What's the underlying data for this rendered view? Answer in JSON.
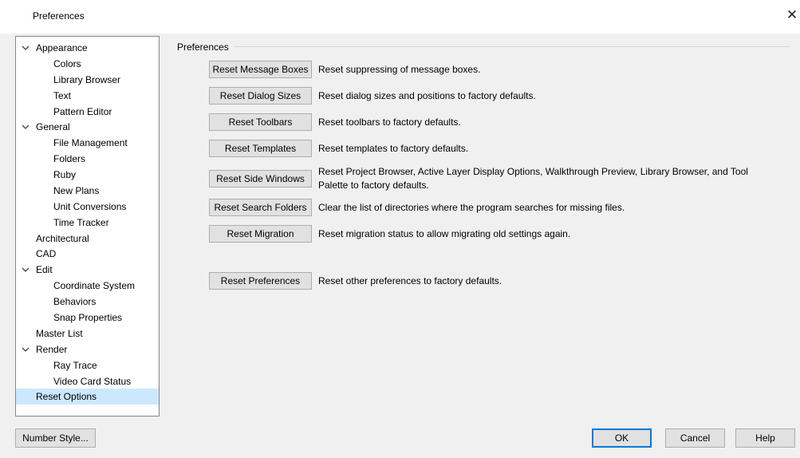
{
  "window": {
    "title": "Preferences",
    "close_glyph": "✕"
  },
  "tree": {
    "items": [
      {
        "label": "Appearance",
        "expanded": true
      },
      {
        "label": "Colors"
      },
      {
        "label": "Library Browser"
      },
      {
        "label": "Text"
      },
      {
        "label": "Pattern Editor"
      },
      {
        "label": "General",
        "expanded": true
      },
      {
        "label": "File Management"
      },
      {
        "label": "Folders"
      },
      {
        "label": "Ruby"
      },
      {
        "label": "New Plans"
      },
      {
        "label": "Unit Conversions"
      },
      {
        "label": "Time Tracker"
      },
      {
        "label": "Architectural"
      },
      {
        "label": "CAD"
      },
      {
        "label": "Edit",
        "expanded": true
      },
      {
        "label": "Coordinate System"
      },
      {
        "label": "Behaviors"
      },
      {
        "label": "Snap Properties"
      },
      {
        "label": "Master List"
      },
      {
        "label": "Render",
        "expanded": true
      },
      {
        "label": "Ray Trace"
      },
      {
        "label": "Video Card Status"
      },
      {
        "label": "Reset Options",
        "selected": true
      }
    ]
  },
  "group": {
    "label": "Preferences"
  },
  "resets": [
    {
      "button": "Reset Message Boxes",
      "description": "Reset suppressing of message boxes."
    },
    {
      "button": "Reset Dialog Sizes",
      "description": "Reset dialog sizes and positions to factory defaults."
    },
    {
      "button": "Reset Toolbars",
      "description": "Reset toolbars to factory defaults."
    },
    {
      "button": "Reset Templates",
      "description": "Reset templates to factory defaults."
    },
    {
      "button": "Reset Side Windows",
      "description_line1": "Reset Project Browser, Active Layer Display Options, Walkthrough Preview, Library Browser, and Tool",
      "description_line2": "Palette to factory defaults."
    },
    {
      "button": "Reset Search Folders",
      "description": "Clear the list of directories where the program searches for missing files."
    },
    {
      "button": "Reset Migration",
      "description": "Reset migration status to allow migrating old settings again."
    },
    {
      "button": "Reset Preferences",
      "description": "Reset other preferences to factory defaults."
    }
  ],
  "footer": {
    "number_style": "Number Style...",
    "ok": "OK",
    "cancel": "Cancel",
    "help": "Help"
  },
  "colors": {
    "selection": "#cce8ff",
    "default_button_border": "#0078d7"
  }
}
